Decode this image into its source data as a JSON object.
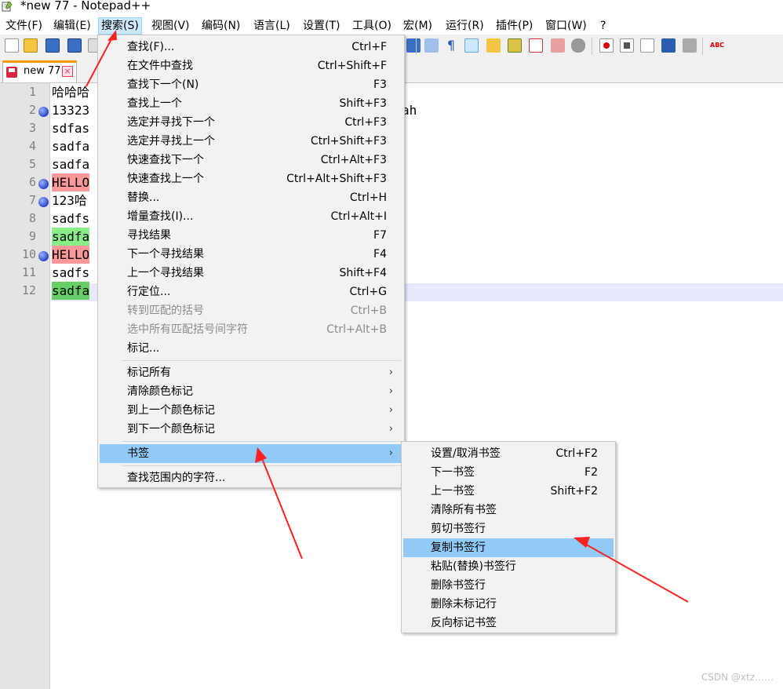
{
  "window": {
    "title": "*new 77 - Notepad++"
  },
  "menubar": {
    "items": [
      {
        "label": "文件(F)"
      },
      {
        "label": "编辑(E)"
      },
      {
        "label": "搜索(S)"
      },
      {
        "label": "视图(V)"
      },
      {
        "label": "编码(N)"
      },
      {
        "label": "语言(L)"
      },
      {
        "label": "设置(T)"
      },
      {
        "label": "工具(O)"
      },
      {
        "label": "宏(M)"
      },
      {
        "label": "运行(R)"
      },
      {
        "label": "插件(P)"
      },
      {
        "label": "窗口(W)"
      },
      {
        "label": "?"
      }
    ]
  },
  "tab": {
    "label": "new 77",
    "close": "×"
  },
  "editor": {
    "line_numbers": [
      "1",
      "2",
      "3",
      "4",
      "5",
      "6",
      "7",
      "8",
      "9",
      "10",
      "11",
      "12"
    ],
    "lines": [
      {
        "text": "哈哈哈"
      },
      {
        "text": "13323",
        "tail": "ah"
      },
      {
        "text": "sdfas"
      },
      {
        "text": "sadfa"
      },
      {
        "text": "sadfa"
      },
      {
        "text": "HELLO"
      },
      {
        "text": "123哈"
      },
      {
        "text": "sadfs"
      },
      {
        "text": "sadfa"
      },
      {
        "text": "HELLO"
      },
      {
        "text": "sadfs"
      },
      {
        "text": "sadfa"
      }
    ],
    "bookmark_color": "#2a44c8",
    "mark_red": "#ff9898",
    "mark_green": "#88ee88"
  },
  "search_menu": {
    "items": [
      {
        "label": "查找(F)...",
        "shortcut": "Ctrl+F"
      },
      {
        "label": "在文件中查找",
        "shortcut": "Ctrl+Shift+F"
      },
      {
        "label": "查找下一个(N)",
        "shortcut": "F3"
      },
      {
        "label": "查找上一个",
        "shortcut": "Shift+F3"
      },
      {
        "label": "选定并寻找下一个",
        "shortcut": "Ctrl+F3"
      },
      {
        "label": "选定并寻找上一个",
        "shortcut": "Ctrl+Shift+F3"
      },
      {
        "label": "快速查找下一个",
        "shortcut": "Ctrl+Alt+F3"
      },
      {
        "label": "快速查找上一个",
        "shortcut": "Ctrl+Alt+Shift+F3"
      },
      {
        "label": "替换...",
        "shortcut": "Ctrl+H"
      },
      {
        "label": "增量查找(I)...",
        "shortcut": "Ctrl+Alt+I"
      },
      {
        "label": "寻找结果",
        "shortcut": "F7"
      },
      {
        "label": "下一个寻找结果",
        "shortcut": "F4"
      },
      {
        "label": "上一个寻找结果",
        "shortcut": "Shift+F4"
      },
      {
        "label": "行定位...",
        "shortcut": "Ctrl+G"
      },
      {
        "label": "转到匹配的括号",
        "shortcut": "Ctrl+B",
        "disabled": true
      },
      {
        "label": "选中所有匹配括号间字符",
        "shortcut": "Ctrl+Alt+B",
        "disabled": true
      },
      {
        "label": "标记...",
        "shortcut": ""
      }
    ],
    "mark_group": [
      {
        "label": "标记所有",
        "arrow": "›"
      },
      {
        "label": "清除颜色标记",
        "arrow": "›"
      },
      {
        "label": "到上一个颜色标记",
        "arrow": "›"
      },
      {
        "label": "到下一个颜色标记",
        "arrow": "›"
      }
    ],
    "bookmark_item": {
      "label": "书签",
      "arrow": "›"
    },
    "last_item": {
      "label": "查找范围内的字符..."
    }
  },
  "bookmark_submenu": {
    "items": [
      {
        "label": "设置/取消书签",
        "shortcut": "Ctrl+F2"
      },
      {
        "label": "下一书签",
        "shortcut": "F2"
      },
      {
        "label": "上一书签",
        "shortcut": "Shift+F2"
      },
      {
        "label": "清除所有书签",
        "shortcut": ""
      },
      {
        "label": "剪切书签行",
        "shortcut": ""
      },
      {
        "label": "复制书签行",
        "shortcut": "",
        "highlighted": true
      },
      {
        "label": "粘贴(替换)书签行",
        "shortcut": ""
      },
      {
        "label": "删除书签行",
        "shortcut": ""
      },
      {
        "label": "删除未标记行",
        "shortcut": ""
      },
      {
        "label": "反向标记书签",
        "shortcut": ""
      }
    ]
  },
  "colors": {
    "menu_highlight": "#91c9f7",
    "active_menu": "#cce8ff",
    "annotation_arrow": "#ff2020",
    "tab_accent": "#ff9900"
  },
  "watermark": "CSDN @xtz……"
}
